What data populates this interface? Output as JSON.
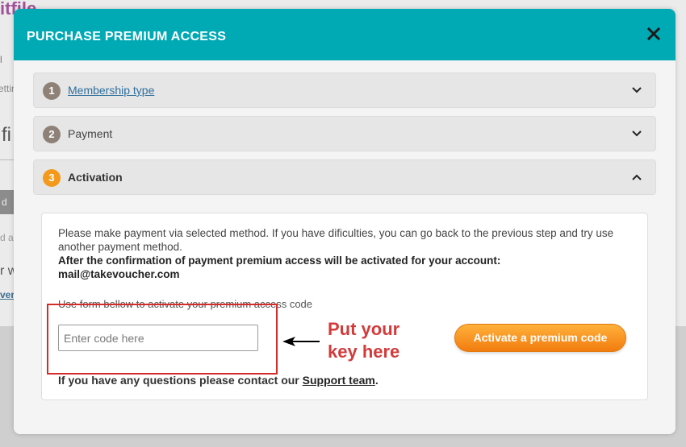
{
  "background": {
    "logo_fragment": "itfile",
    "left_fragments": [
      "l",
      "ettin",
      "fi",
      "d",
      "d a",
      "r w",
      "ver"
    ]
  },
  "modal": {
    "title": "PURCHASE PREMIUM ACCESS",
    "close_icon": "close-icon",
    "steps": [
      {
        "number": "1",
        "label": "Membership type",
        "state": "done",
        "expanded": false
      },
      {
        "number": "2",
        "label": "Payment",
        "state": "done",
        "expanded": false
      },
      {
        "number": "3",
        "label": "Activation",
        "state": "active",
        "expanded": true
      }
    ],
    "activation": {
      "message": "Please make payment via selected method. If you have dificulties, you can go back to the previous step and try use another payment method.",
      "confirmation": "After the confirmation of payment premium access will be activated for your account:",
      "email": "mail@takevoucher.com",
      "form_hint": "Use form bellow to activate your premium access code",
      "code_input": {
        "value": "",
        "placeholder": "Enter code here"
      },
      "activate_button": "Activate a premium code",
      "support_prefix": "If you have any questions please contact our",
      "support_link": "Support team",
      "support_suffix": "."
    }
  },
  "annotation": {
    "text_line1": "Put your",
    "text_line2": "key here",
    "color": "#d33b3b"
  },
  "colors": {
    "header": "#00aab5",
    "step_done": "#8e8278",
    "step_active": "#f39a1c",
    "button": "#f5881a"
  }
}
